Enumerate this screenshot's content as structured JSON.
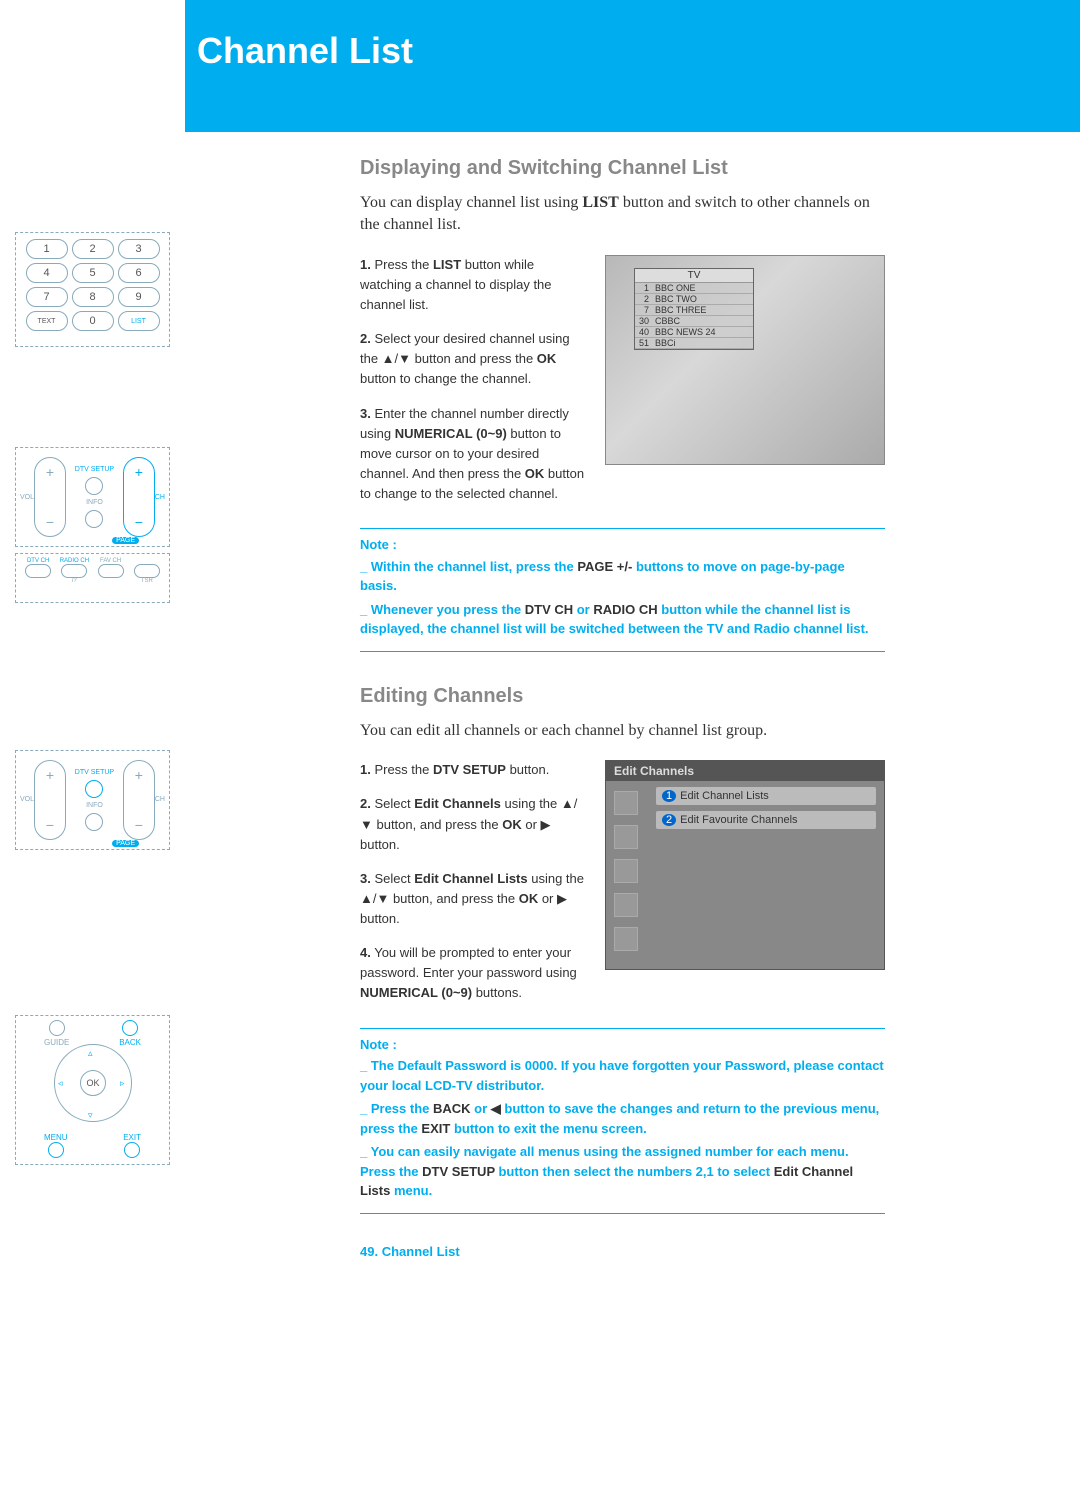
{
  "header": {
    "title": "Channel List"
  },
  "section1": {
    "heading": "Displaying and Switching Channel List",
    "intro_a": "You can display channel list using ",
    "intro_b": "LIST",
    "intro_c": " button and switch to other channels on the channel list.",
    "steps": [
      {
        "n": "1.",
        "pre": " Press the ",
        "b1": "LIST",
        "post": " button while watching a channel to display the channel list."
      },
      {
        "n": "2.",
        "pre": " Select your desired channel using the ▲/▼ button and press the ",
        "b1": "OK",
        "post": " button to change the channel."
      },
      {
        "n": "3.",
        "pre": " Enter the channel number directly using ",
        "b1": "NUMERICAL (0~9)",
        "mid": " button to move cursor on to your desired channel. And then press the ",
        "b2": "OK",
        "post": " button to change to the selected channel."
      }
    ],
    "tv_title": "TV",
    "tv_rows": [
      {
        "num": "1",
        "name": "BBC ONE"
      },
      {
        "num": "2",
        "name": "BBC TWO"
      },
      {
        "num": "7",
        "name": "BBC THREE"
      },
      {
        "num": "30",
        "name": "CBBC"
      },
      {
        "num": "40",
        "name": "BBC NEWS 24"
      },
      {
        "num": "51",
        "name": "BBCi"
      }
    ],
    "note_title": "Note :",
    "note1_a": "_ Within the channel list, press the ",
    "note1_b": "PAGE +/-",
    "note1_c": " buttons to move on page-by-page basis.",
    "note2_a": "_ Whenever you press the ",
    "note2_b": "DTV CH",
    "note2_c": " or ",
    "note2_d": "RADIO CH",
    "note2_e": " button while the channel list is displayed, the channel list will be switched between the TV and Radio channel list."
  },
  "section2": {
    "heading": "Editing Channels",
    "intro": "You can edit all channels or each channel by channel list group.",
    "steps": [
      {
        "n": "1.",
        "pre": " Press the ",
        "b1": "DTV SETUP",
        "post": " button."
      },
      {
        "n": "2.",
        "pre": " Select ",
        "b1": "Edit Channels",
        "mid": " using the ▲/▼ button, and press the ",
        "b2": "OK",
        "mid2": " or ",
        "sym": "▶",
        "post": " button."
      },
      {
        "n": "3.",
        "pre": " Select ",
        "b1": "Edit Channel Lists",
        "mid": " using the ▲/▼ button, and press the ",
        "b2": "OK",
        "mid2": " or ",
        "sym": "▶",
        "post": " button."
      },
      {
        "n": "4.",
        "pre": " You will be prompted to enter your password. Enter your password using ",
        "b1": "NUMERICAL (0~9)",
        "post": " buttons."
      }
    ],
    "menu_title": "Edit Channels",
    "menu_items": [
      {
        "num": "1",
        "label": "Edit Channel Lists"
      },
      {
        "num": "2",
        "label": "Edit Favourite Channels"
      }
    ],
    "note_title": "Note :",
    "note1_a": "_ The Default Password is 0000. If you have forgotten your Password, please contact your local LCD-TV distributor.",
    "note2_a": "_ Press the ",
    "note2_b": "BACK",
    "note2_c": " or ",
    "note2_sym": "◀",
    "note2_d": " button to save the changes and return to the previous menu, press the  ",
    "note2_e": "EXIT",
    "note2_f": " button to exit the menu screen.",
    "note3_a": "_ You can easily navigate all menus using the assigned number for each menu. Press the ",
    "note3_b": "DTV SETUP",
    "note3_c": " button then select the numbers 2,1 to select ",
    "note3_d": "Edit Channel Lists",
    "note3_e": " menu."
  },
  "remote": {
    "keys": [
      "1",
      "2",
      "3",
      "4",
      "5",
      "6",
      "7",
      "8",
      "9",
      "TEXT",
      "0",
      "LIST"
    ],
    "dtv_setup": "DTV SETUP",
    "info": "INFO",
    "vol": "VOL",
    "ch": "CH",
    "page": "PAGE",
    "dtvch": "DTV CH",
    "radioch": "RADIO CH",
    "favch": "FAV CH",
    "tsr": "TSR",
    "guide": "GUIDE",
    "back": "BACK",
    "menu": "MENU",
    "exit": "EXIT",
    "ok": "OK",
    "q": "i?"
  },
  "footer": {
    "page": "49.",
    "label": "Channel List"
  }
}
